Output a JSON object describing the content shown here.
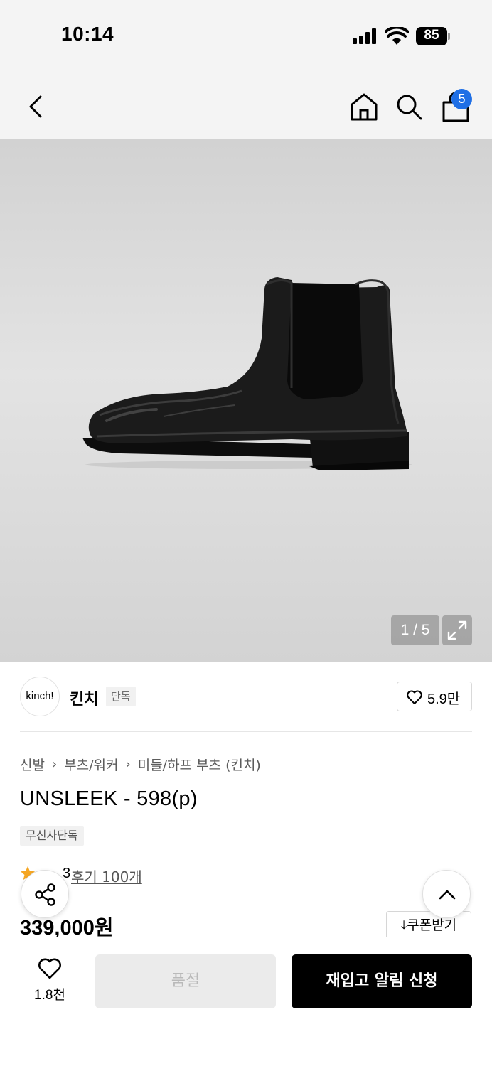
{
  "status_bar": {
    "time": "10:14",
    "battery": "85"
  },
  "nav": {
    "cart_badge": "5"
  },
  "gallery": {
    "pager": "1 / 5"
  },
  "brand": {
    "logo_text": "kinch!",
    "name": "킨치",
    "tag": "단독",
    "likes": "5.9만"
  },
  "breadcrumb": [
    "신발",
    "부츠/워커",
    "미들/하프 부츠 (킨치)"
  ],
  "product": {
    "title": "UNSLEEK - 598(p)",
    "exclusive_tag": "무신사단독",
    "rating": "3",
    "review_link": "후기 100개",
    "price": "339,000원",
    "coupon_label": "쿠폰받기"
  },
  "bottom_bar": {
    "wish_count": "1.8천",
    "soldout_label": "품절",
    "restock_label": "재입고 알림 신청"
  },
  "colors": {
    "badge": "#1f6fe5",
    "star": "#f5a623",
    "primary_button": "#000000"
  },
  "icons": [
    "back-icon",
    "home-icon",
    "search-icon",
    "bag-icon",
    "expand-icon",
    "heart-icon",
    "share-icon",
    "chevron-up-icon",
    "download-icon",
    "star-icon"
  ]
}
